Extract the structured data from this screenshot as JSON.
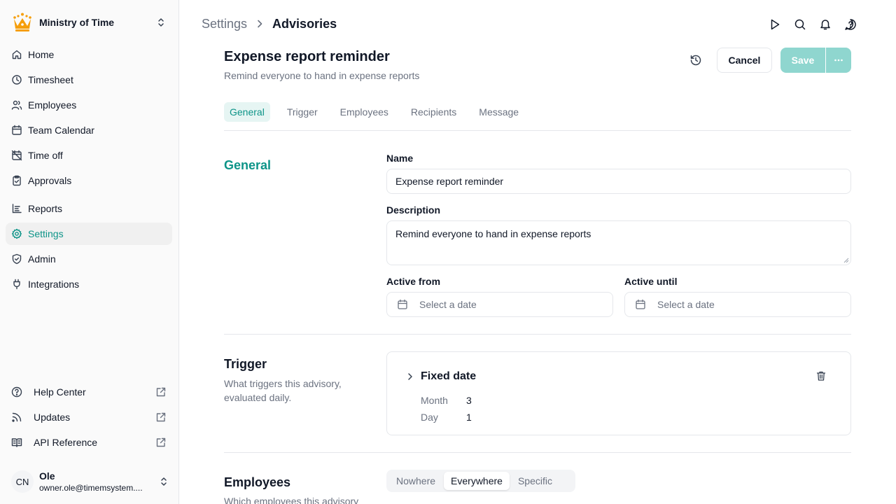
{
  "org": {
    "name": "Ministry of Time"
  },
  "nav": {
    "home": "Home",
    "timesheet": "Timesheet",
    "employees": "Employees",
    "team_calendar": "Team Calendar",
    "time_off": "Time off",
    "approvals": "Approvals",
    "reports": "Reports",
    "settings": "Settings",
    "admin": "Admin",
    "integrations": "Integrations"
  },
  "footer_links": {
    "help_center": "Help Center",
    "updates": "Updates",
    "api_reference": "API Reference"
  },
  "user": {
    "initials": "CN",
    "name": "Ole",
    "email": "owner.ole@timemsystem...."
  },
  "breadcrumb": {
    "parent": "Settings",
    "current": "Advisories"
  },
  "header": {
    "title": "Expense report reminder",
    "subtitle": "Remind everyone to hand in expense reports",
    "cancel_label": "Cancel",
    "save_label": "Save"
  },
  "tabs": [
    "General",
    "Trigger",
    "Employees",
    "Recipients",
    "Message"
  ],
  "general": {
    "section_title": "General",
    "name_label": "Name",
    "name_value": "Expense report reminder",
    "description_label": "Description",
    "description_value": "Remind everyone to hand in expense reports",
    "active_from_label": "Active from",
    "active_from_placeholder": "Select a date",
    "active_until_label": "Active until",
    "active_until_placeholder": "Select a date"
  },
  "trigger": {
    "section_title": "Trigger",
    "description": "What triggers this advisory, evaluated daily.",
    "type": "Fixed date",
    "month_label": "Month",
    "month_value": "3",
    "day_label": "Day",
    "day_value": "1"
  },
  "employees_section": {
    "section_title": "Employees",
    "description": "Which employees this advisory",
    "options": [
      "Nowhere",
      "Everywhere",
      "Specific"
    ],
    "selected": "Everywhere"
  },
  "colors": {
    "accent": "#0d9488",
    "save_disabled": "#8fd6cf",
    "crown": "#f59e0b"
  }
}
